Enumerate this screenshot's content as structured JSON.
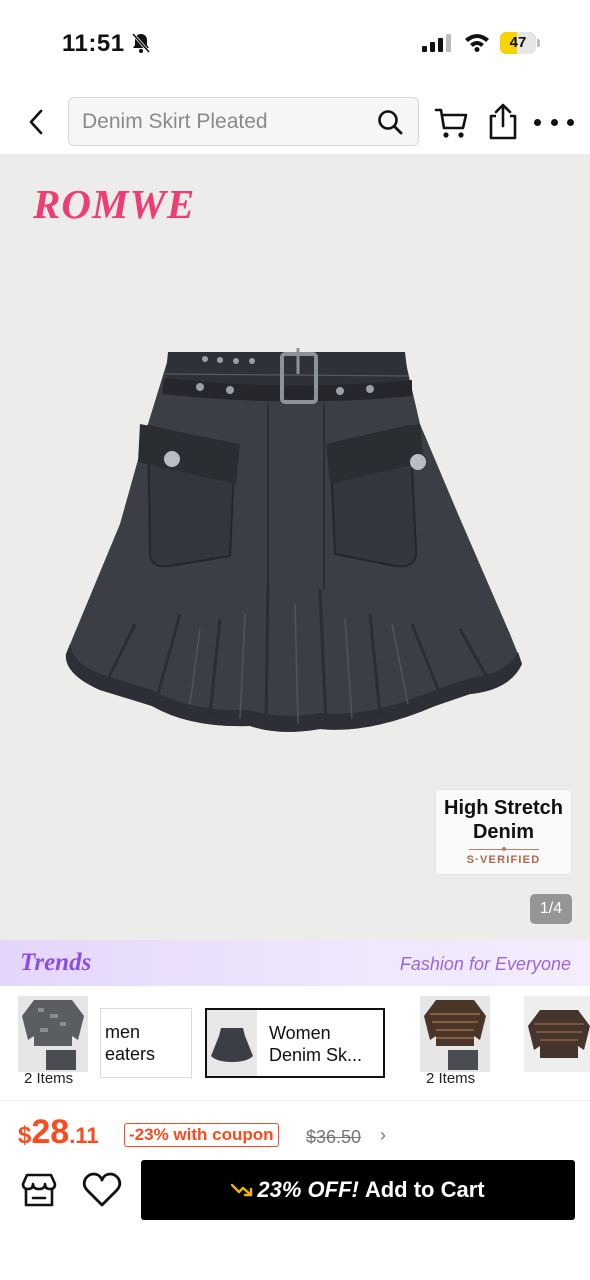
{
  "status_bar": {
    "time": "11:51",
    "battery": "47",
    "battery_level": 0.47
  },
  "header": {
    "search_text": "Denim Skirt Pleated"
  },
  "hero": {
    "brand": "ROMWE",
    "badge_title_line1": "High Stretch",
    "badge_title_line2": "Denim",
    "badge_subtitle": "S·VERIFIED",
    "page_counter": "1/4"
  },
  "trends": {
    "logo": "Trends",
    "tagline": "Fashion for Everyone"
  },
  "carousel": {
    "items": [
      {
        "type": "image",
        "label": "2 Items"
      },
      {
        "type": "text",
        "line1": "men",
        "line2": "eaters"
      },
      {
        "type": "text",
        "line1": "Women",
        "line2": "Denim Sk...",
        "selected": true
      },
      {
        "type": "image",
        "label": "2 Items"
      },
      {
        "type": "image",
        "label": ""
      }
    ]
  },
  "price": {
    "currency": "$",
    "integer": "28",
    "decimal": ".11",
    "coupon": "-23% with coupon",
    "original": "$36.50"
  },
  "bottom_bar": {
    "discount_label": "23% OFF!",
    "cta_label": "Add to Cart"
  },
  "colors": {
    "accent": "#fa4b1d",
    "brand_pink": "#ee3c74",
    "trends_purple": "#8b4fdf",
    "cta_bg": "#000000"
  }
}
